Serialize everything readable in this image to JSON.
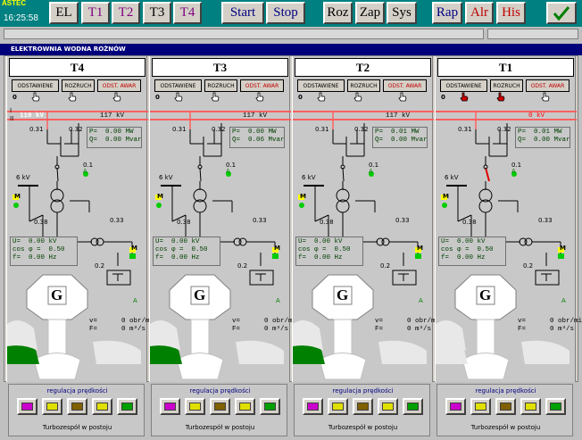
{
  "app": {
    "brand": "ASTEC",
    "clock": "16:25:58"
  },
  "toolbar": [
    {
      "label": "EL",
      "color": "#000000"
    },
    {
      "label": "T1",
      "color": "#800080"
    },
    {
      "label": "T2",
      "color": "#800080"
    },
    {
      "label": "T3",
      "color": "#000000"
    },
    {
      "label": "T4",
      "color": "#800080"
    },
    {
      "label": "Start",
      "color": "#000080"
    },
    {
      "label": "Stop",
      "color": "#000080"
    },
    {
      "label": "Roz",
      "color": "#000000"
    },
    {
      "label": "Zap",
      "color": "#000000"
    },
    {
      "label": "Sys",
      "color": "#000000"
    },
    {
      "label": "Rap",
      "color": "#000080"
    },
    {
      "label": "Alr",
      "color": "#c00000"
    },
    {
      "label": "His",
      "color": "#c00000"
    }
  ],
  "window_title": "ELEKTROWNIA WODNA ROŻNÓW",
  "bus": {
    "main_label": "110 kV",
    "roman1": "I",
    "roman2": "II",
    "line_color": "#ff8080"
  },
  "turbines": [
    {
      "name": "T4",
      "bus_kv": "117 kV",
      "btn1": "ODSTAWIENE",
      "btn2": "ROZRUCH",
      "btn3": "ODST. AWAR",
      "counter": "0",
      "P": "P=  0.00 MW",
      "Q": "Q=  0.00 Mvar",
      "kv6": "6 kV",
      "U": "U=  0.00 kV",
      "cos": "cos φ =  0.50",
      "f": "f=  0.00 Hz",
      "v": "v=      0 obr/min",
      "F": "F=      0 m³/s",
      "lbl031": "0.31",
      "lbl032": "0.32",
      "lbl01": "0.1",
      "lbl038": "0.38",
      "lbl033": "0.33",
      "lbl02": "0.2",
      "A1": "A",
      "A2": "A",
      "M": "M",
      "G": "G",
      "reg": "regulacja prędkości",
      "status": "Turbozespół w postoju"
    },
    {
      "name": "T3",
      "bus_kv": "117 kV",
      "btn1": "ODSTAWIENE",
      "btn2": "ROZRUCH",
      "btn3": "ODST. AWAR",
      "counter": "0",
      "P": "P=  0.00 MW",
      "Q": "Q=  0.06 Mvar",
      "kv6": "6 kV",
      "U": "U=  0.00 kV",
      "cos": "cos φ =  0.50",
      "f": "f=  0.00 Hz",
      "v": "v=      0 obr/min",
      "F": "F=      0 m³/s",
      "lbl031": "0.31",
      "lbl032": "0.32",
      "lbl01": "0.1",
      "lbl038": "0.38",
      "lbl033": "0.33",
      "lbl02": "0.2",
      "A1": "A",
      "A2": "A",
      "M": "M",
      "G": "G",
      "reg": "regulacja prędkości",
      "status": "Turbozespół w postoju"
    },
    {
      "name": "T2",
      "bus_kv": "117 kV",
      "btn1": "ODSTAWIENE",
      "btn2": "ROZRUCH",
      "btn3": "ODST. AWAR",
      "counter": "0",
      "P": "P=  0.01 MW",
      "Q": "Q=  0.00 Mvar",
      "kv6": "6 kV",
      "U": "U=  0.00 kV",
      "cos": "cos φ =  0.50",
      "f": "f=  0.00 Hz",
      "v": "v=      0 obr/min",
      "F": "F=      0 m³/s",
      "lbl031": "0.31",
      "lbl032": "0.32",
      "lbl01": "0.1",
      "lbl038": "0.38",
      "lbl033": "0.33",
      "lbl02": "0.2",
      "A1": "A",
      "A2": "A",
      "M": "M",
      "G": "G",
      "reg": "regulacja prędkości",
      "status": "Turbozespół w postoju"
    },
    {
      "name": "T1",
      "bus_kv": "0 kV",
      "btn1": "ODSTAWIENE",
      "btn2": "ROZRUCH",
      "btn3": "ODST. AWAR",
      "counter": "0",
      "P": "P=  0.01 MW",
      "Q": "Q=  0.00 Mvar",
      "kv6": "6 kV",
      "U": "U=  0.00 kV",
      "cos": "cos φ =  0.50",
      "f": "f=  0.00 Hz",
      "v": "v=      0 obr/min",
      "F": "F=      0 m³/s",
      "lbl031": "0.31",
      "lbl032": "0.32",
      "lbl01": "0.1",
      "lbl038": "0.38",
      "lbl033": "0.33",
      "lbl02": "0.2",
      "A1": "A",
      "A2": "A",
      "M": "M",
      "G": "G",
      "reg": "regulacja prędkości",
      "status": "Turbozespół w postoju"
    }
  ],
  "colors": {
    "panel": "#c8c8c8",
    "title_bar": "#00007b",
    "toolbar_bg": "#008080",
    "water_green": "#008000",
    "bus_red": "#ff6060"
  },
  "icons": [
    "hand-pointer-icon",
    "red-hand-icon",
    "checkmark-icon",
    "up-arrow-icon",
    "lightning-icon",
    "drop-icon",
    "wave-icon",
    "grid-icon"
  ]
}
